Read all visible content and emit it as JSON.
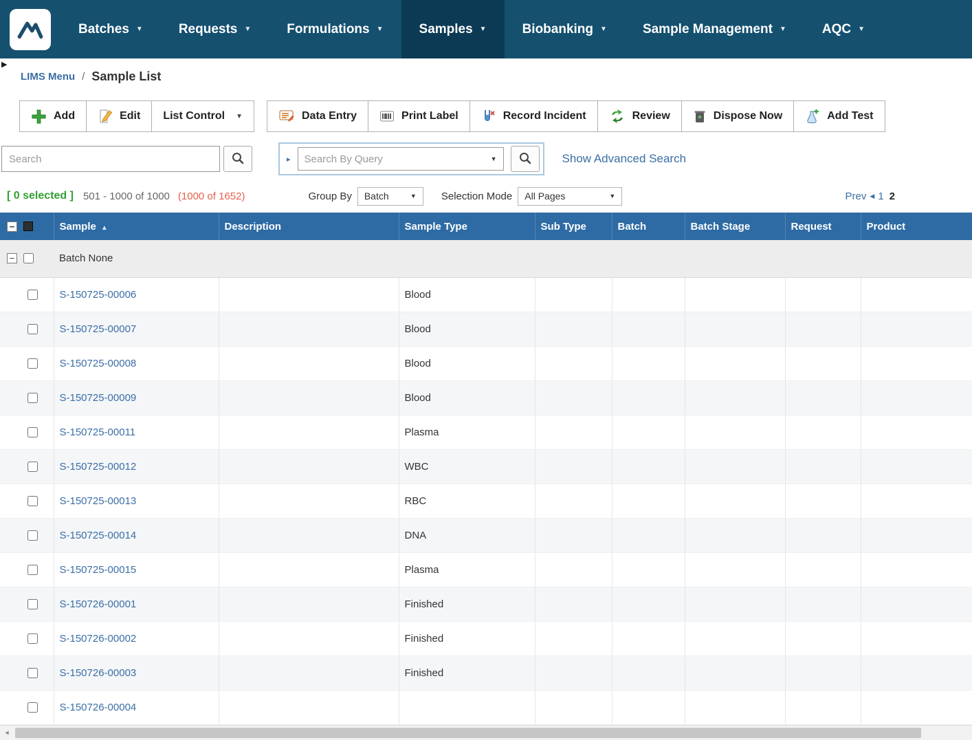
{
  "colors": {
    "nav_bg": "#15506f",
    "nav_active_bg": "#0c3a54",
    "header_bg": "#2e6ba4",
    "link": "#3a6ea5",
    "selected_green": "#33a033",
    "filtered_red": "#e8604c"
  },
  "nav": {
    "items": [
      {
        "label": "Batches"
      },
      {
        "label": "Requests"
      },
      {
        "label": "Formulations"
      },
      {
        "label": "Samples",
        "active": true
      },
      {
        "label": "Biobanking"
      },
      {
        "label": "Sample Management"
      },
      {
        "label": "AQC"
      }
    ]
  },
  "breadcrumb": {
    "parent": "LIMS Menu",
    "separator": "/",
    "current": "Sample List"
  },
  "toolbar": {
    "buttons": [
      {
        "label": "Add"
      },
      {
        "label": "Edit"
      },
      {
        "label": "List Control"
      },
      {
        "label": "Data Entry"
      },
      {
        "label": "Print Label"
      },
      {
        "label": "Record Incident"
      },
      {
        "label": "Review"
      },
      {
        "label": "Dispose Now"
      },
      {
        "label": "Add Test"
      }
    ]
  },
  "search": {
    "simple_placeholder": "Search",
    "query_placeholder": "Search By Query",
    "advanced_search_label": "Show Advanced Search"
  },
  "status_bar": {
    "selected_text": "[ 0 selected ]",
    "range_text": "501 - 1000 of 1000",
    "filtered_text": "(1000 of 1652)",
    "group_by_label": "Group By",
    "group_by_value": "Batch",
    "selection_mode_label": "Selection Mode",
    "selection_mode_value": "All Pages",
    "pagination": {
      "prev_label": "Prev",
      "pages": [
        {
          "label": "1",
          "current": false
        },
        {
          "label": "2",
          "current": true
        }
      ]
    }
  },
  "table": {
    "columns": [
      {
        "label": "Sample",
        "sorted": "asc"
      },
      {
        "label": "Description"
      },
      {
        "label": "Sample Type"
      },
      {
        "label": "Sub Type"
      },
      {
        "label": "Batch"
      },
      {
        "label": "Batch Stage"
      },
      {
        "label": "Request"
      },
      {
        "label": "Product"
      }
    ],
    "group_row": {
      "label": "Batch None"
    },
    "rows": [
      {
        "sample": "S-150725-00006",
        "sample_type": "Blood"
      },
      {
        "sample": "S-150725-00007",
        "sample_type": "Blood"
      },
      {
        "sample": "S-150725-00008",
        "sample_type": "Blood"
      },
      {
        "sample": "S-150725-00009",
        "sample_type": "Blood"
      },
      {
        "sample": "S-150725-00011",
        "sample_type": "Plasma"
      },
      {
        "sample": "S-150725-00012",
        "sample_type": "WBC"
      },
      {
        "sample": "S-150725-00013",
        "sample_type": "RBC"
      },
      {
        "sample": "S-150725-00014",
        "sample_type": "DNA"
      },
      {
        "sample": "S-150725-00015",
        "sample_type": "Plasma"
      },
      {
        "sample": "S-150726-00001",
        "sample_type": "Finished"
      },
      {
        "sample": "S-150726-00002",
        "sample_type": "Finished"
      },
      {
        "sample": "S-150726-00003",
        "sample_type": "Finished"
      },
      {
        "sample": "S-150726-00004",
        "sample_type": ""
      }
    ]
  },
  "icons": {
    "caret_down": "▼",
    "select_caret": "▼",
    "sort_asc": "▲",
    "collapse_minus": "−",
    "sidebar_expand": "▶",
    "query_expand": "▸",
    "prev_arrow": "◀",
    "scroll_left": "◄"
  }
}
